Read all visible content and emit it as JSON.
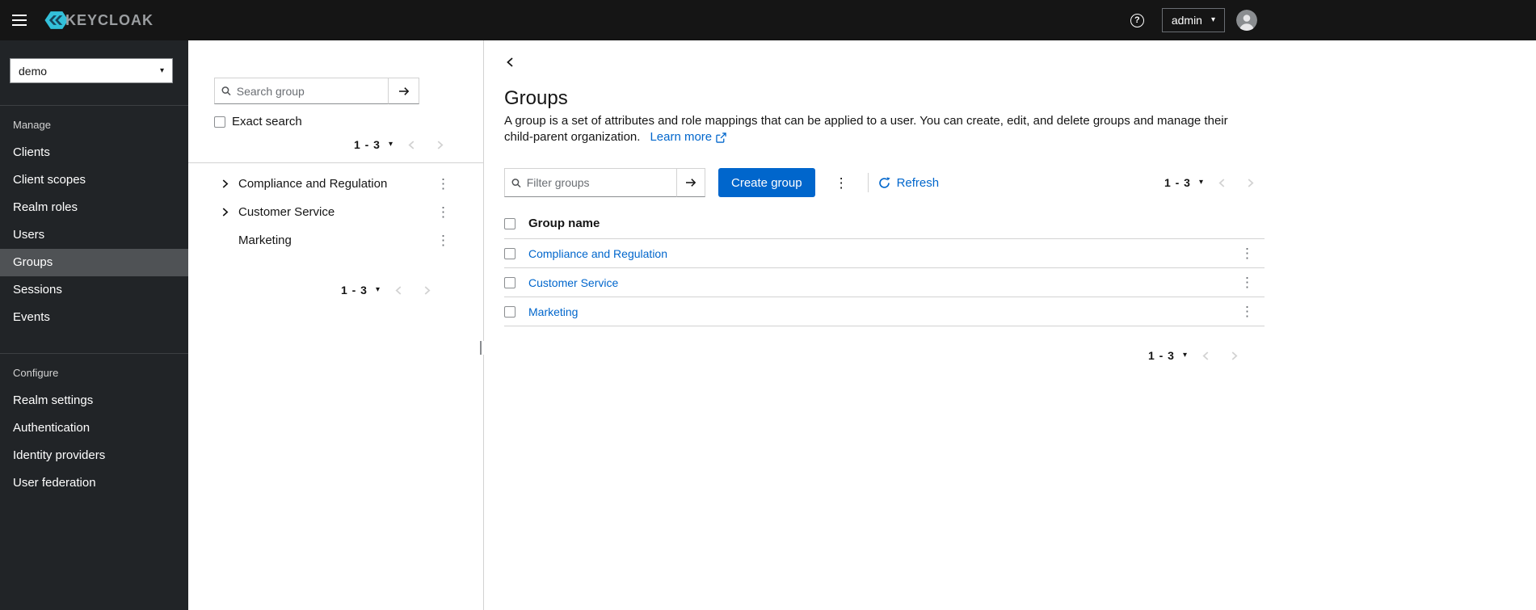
{
  "colors": {
    "primary": "#0066cc",
    "link": "#0066cc",
    "header_bg": "#151515",
    "sidebar_bg": "#212427",
    "sidebar_selected_bg": "#4f5255",
    "logo_cyan": "#33c0da",
    "border": "#d2d2d2"
  },
  "icons": {
    "kebab_menu": "⋮",
    "caret_down": "▾",
    "help": "?"
  },
  "header": {
    "brand_text": "KEYCLOAK",
    "username": "admin"
  },
  "sidebar": {
    "realm": "demo",
    "sections": [
      {
        "label": "Manage",
        "items": [
          {
            "label": "Clients"
          },
          {
            "label": "Client scopes"
          },
          {
            "label": "Realm roles"
          },
          {
            "label": "Users"
          },
          {
            "label": "Groups",
            "selected": true
          },
          {
            "label": "Sessions"
          },
          {
            "label": "Events"
          }
        ]
      },
      {
        "label": "Configure",
        "items": [
          {
            "label": "Realm settings"
          },
          {
            "label": "Authentication"
          },
          {
            "label": "Identity providers"
          },
          {
            "label": "User federation"
          }
        ]
      }
    ]
  },
  "tree_panel": {
    "search_placeholder": "Search group",
    "exact_search_label": "Exact search",
    "pagination": {
      "range": "1 - 3"
    },
    "bottom_pagination": {
      "range": "1 - 3"
    },
    "items": [
      {
        "name": "Compliance and Regulation",
        "expandable": true
      },
      {
        "name": "Customer Service",
        "expandable": true
      },
      {
        "name": "Marketing",
        "expandable": false
      }
    ]
  },
  "main": {
    "title": "Groups",
    "description": "A group is a set of attributes and role mappings that can be applied to a user. You can create, edit, and delete groups and manage their child-parent organization.",
    "learn_more_label": "Learn more",
    "toolbar": {
      "filter_placeholder": "Filter groups",
      "create_button_label": "Create group",
      "refresh_label": "Refresh",
      "pagination": {
        "range": "1 - 3"
      }
    },
    "table": {
      "name_column": "Group name",
      "rows": [
        {
          "name": "Compliance and Regulation"
        },
        {
          "name": "Customer Service"
        },
        {
          "name": "Marketing"
        }
      ]
    },
    "bottom_pagination": {
      "range": "1 - 3"
    }
  }
}
